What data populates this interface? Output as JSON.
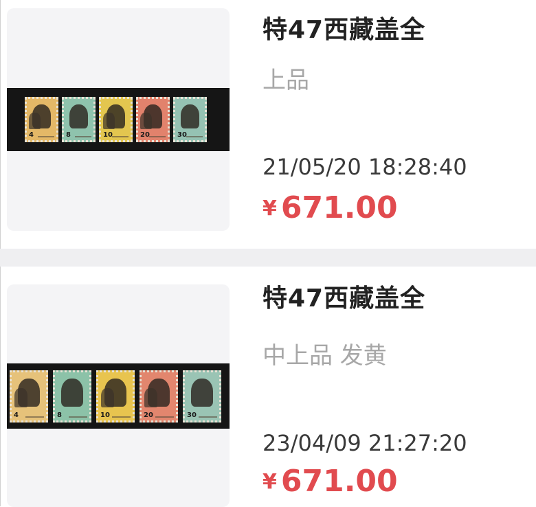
{
  "listings": [
    {
      "title": "特47西藏盖全",
      "grade": "上品",
      "timestamp": "21/05/20 18:28:40",
      "currency": "¥",
      "price": "671.00",
      "stamps": [
        {
          "value": "4",
          "color": "#e4b867"
        },
        {
          "value": "8",
          "color": "#8fc3ad"
        },
        {
          "value": "10",
          "color": "#e3c64f"
        },
        {
          "value": "20",
          "color": "#e2826c"
        },
        {
          "value": "30",
          "color": "#95c2b3"
        }
      ]
    },
    {
      "title": "特47西藏盖全",
      "grade": "中上品 发黄",
      "timestamp": "23/04/09 21:27:20",
      "currency": "¥",
      "price": "671.00",
      "stamps": [
        {
          "value": "4",
          "color": "#e6c27a"
        },
        {
          "value": "8",
          "color": "#8cc2a8"
        },
        {
          "value": "10",
          "color": "#e8c44f"
        },
        {
          "value": "20",
          "color": "#e2866e"
        },
        {
          "value": "30",
          "color": "#9ac4b4"
        }
      ]
    }
  ]
}
